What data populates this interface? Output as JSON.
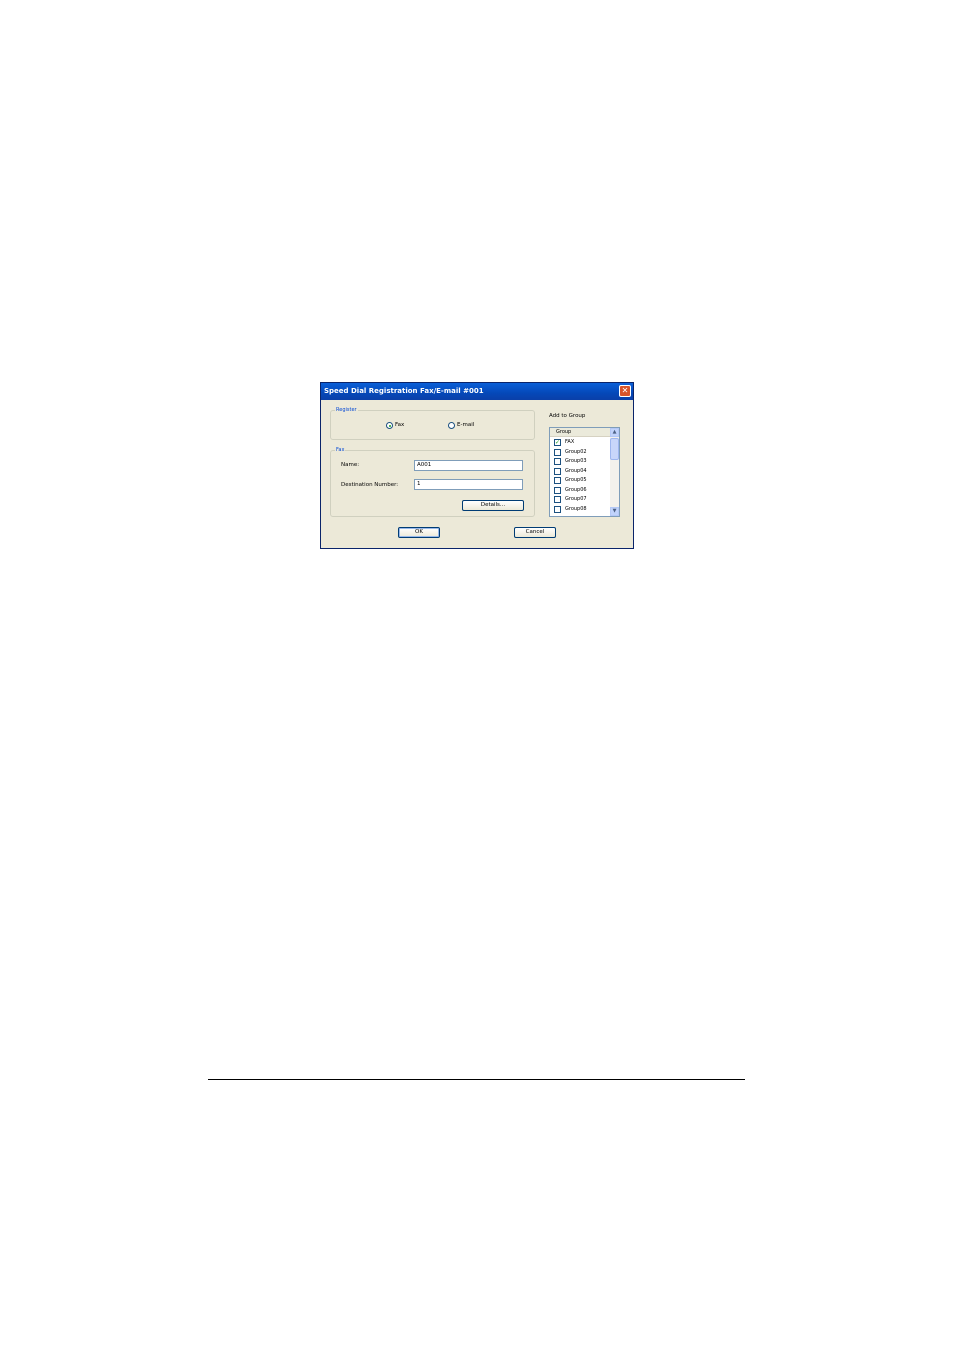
{
  "dialog": {
    "title": "Speed Dial Registration Fax/E-mail #001",
    "close_label": "✕",
    "register": {
      "legend": "Register",
      "options": [
        {
          "label": "Fax",
          "checked": true
        },
        {
          "label": "E-mail",
          "checked": false
        }
      ]
    },
    "fax": {
      "legend": "Fax",
      "name_label": "Name:",
      "name_value": "A001",
      "dest_label": "Destination Number:",
      "dest_value": "1",
      "details_label": "Details..."
    },
    "add_to_group": {
      "label": "Add to Group",
      "column_header": "Group",
      "items": [
        {
          "label": "FAX",
          "checked": true
        },
        {
          "label": "Group02",
          "checked": false
        },
        {
          "label": "Group03",
          "checked": false
        },
        {
          "label": "Group04",
          "checked": false
        },
        {
          "label": "Group05",
          "checked": false
        },
        {
          "label": "Group06",
          "checked": false
        },
        {
          "label": "Group07",
          "checked": false
        },
        {
          "label": "Group08",
          "checked": false
        }
      ],
      "scroll_up": "▲",
      "scroll_down": "▼"
    },
    "ok_label": "OK",
    "cancel_label": "Cancel"
  }
}
